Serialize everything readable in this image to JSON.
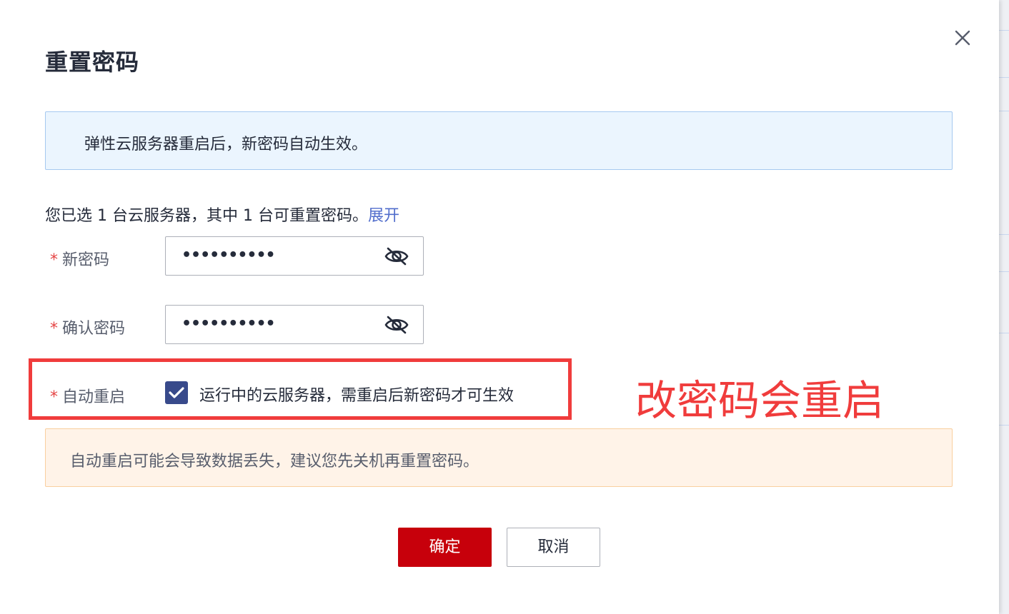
{
  "dialog": {
    "title": "重置密码",
    "close_icon": "close-icon"
  },
  "info": {
    "text": "弹性云服务器重启后，新密码自动生效。"
  },
  "selection": {
    "text": "您已选 1 台云服务器，其中 1 台可重置密码。",
    "expand_label": "展开"
  },
  "form": {
    "required_mark": "*",
    "new_password": {
      "label": "新密码",
      "value": "••••••••••",
      "toggle_icon": "eye-off-icon"
    },
    "confirm_password": {
      "label": "确认密码",
      "value": "••••••••••",
      "toggle_icon": "eye-off-icon"
    },
    "auto_restart": {
      "label": "自动重启",
      "checked": true,
      "checkbox_text": "运行中的云服务器，需重启后新密码才可生效"
    }
  },
  "annotation": {
    "text": "改密码会重启",
    "color": "#f03c3c"
  },
  "warning": {
    "text": "自动重启可能会导致数据丢失，建议您先关机再重置密码。"
  },
  "buttons": {
    "confirm_label": "确定",
    "cancel_label": "取消"
  },
  "colors": {
    "primary_button": "#c7000b",
    "link": "#526ecc",
    "checkbox": "#384a8b",
    "info_bg": "#ebf5fe",
    "warning_bg": "#fff3e8"
  }
}
